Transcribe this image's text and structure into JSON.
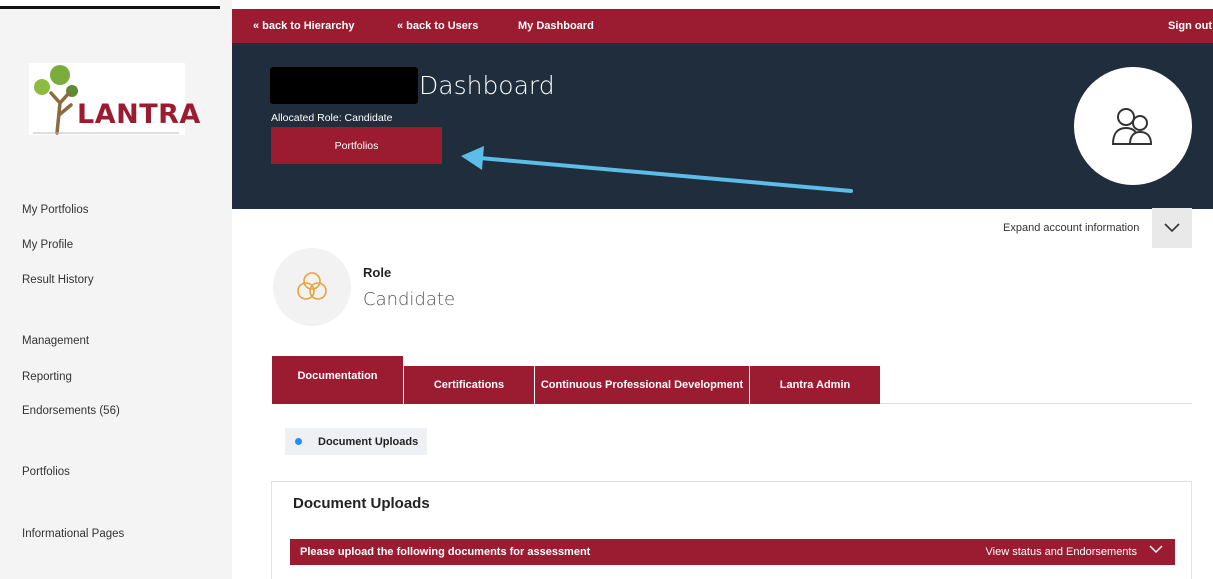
{
  "topbar": {
    "back_hierarchy": "« back to Hierarchy",
    "back_users": "« back to Users",
    "dashboard": "My Dashboard",
    "sign_out": "Sign out"
  },
  "brand": {
    "logo_text": "LANTRA"
  },
  "sidebar": {
    "items": [
      {
        "label": "My Portfolios"
      },
      {
        "label": "My Profile"
      },
      {
        "label": "Result History"
      },
      {
        "label": "Management"
      },
      {
        "label": "Reporting"
      },
      {
        "label": "Endorsements (56)"
      },
      {
        "label": "Portfolios"
      },
      {
        "label": "Informational Pages"
      }
    ]
  },
  "hero": {
    "title": "Dashboard",
    "allocated_role": "Allocated Role: Candidate",
    "portfolios_button": "Portfolios"
  },
  "account": {
    "expand_label": "Expand account information"
  },
  "role": {
    "label": "Role",
    "value": "Candidate"
  },
  "tabs": [
    {
      "label": "Documentation",
      "active": true
    },
    {
      "label": "Certifications"
    },
    {
      "label": "Continuous Professional Development"
    },
    {
      "label": "Lantra Admin"
    }
  ],
  "subtab": {
    "label": "Document Uploads"
  },
  "panel": {
    "title": "Document Uploads",
    "bar_text": "Please upload the following documents for assessment",
    "bar_link": "View status and Endorsements"
  },
  "colors": {
    "brand_red": "#9b1b30",
    "hero_navy": "#1f2d3d",
    "annotation_arrow": "#5bbde8",
    "dot_blue": "#1e90ff"
  },
  "icons": {
    "avatar": "users-outline-icon",
    "role": "venn-circles-icon",
    "expand": "chevron-down-icon"
  }
}
